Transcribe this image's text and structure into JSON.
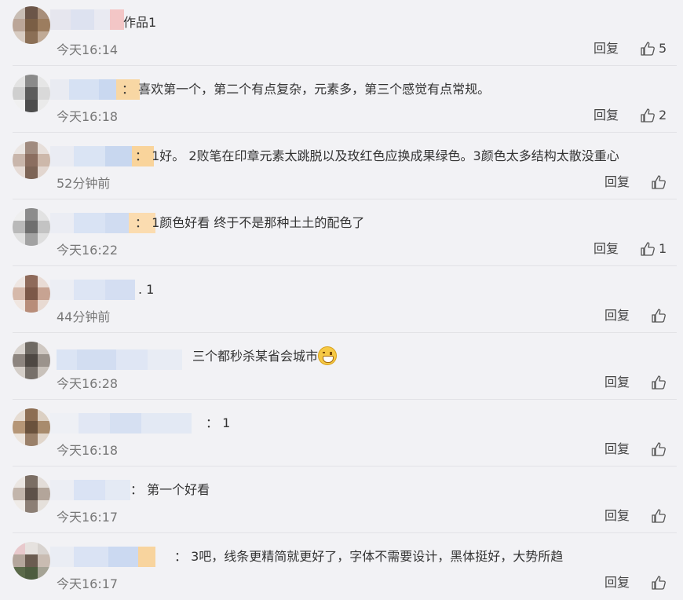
{
  "reply_label": "回复",
  "comments": [
    {
      "text": "作品1",
      "time": "今天16:14",
      "likes": "5"
    },
    {
      "text": "：  喜欢第一个，第二个有点复杂，元素多，第三个感觉有点常规。",
      "time": "今天16:18",
      "likes": "2"
    },
    {
      "text": "：  1好。 2败笔在印章元素太跳脱以及玫红色应换成果绿色。3颜色太多结构太散没重心",
      "time": "52分钟前",
      "likes": ""
    },
    {
      "text": "：  1颜色好看 终于不是那种土土的配色了",
      "time": "今天16:22",
      "likes": "1"
    },
    {
      "text": ".   1",
      "time": "44分钟前",
      "likes": ""
    },
    {
      "text": "三个都秒杀某省会城市",
      "time": "今天16:28",
      "likes": ""
    },
    {
      "text": "：  1",
      "time": "今天16:18",
      "likes": ""
    },
    {
      "text": "：  第一个好看",
      "time": "今天16:17",
      "likes": ""
    },
    {
      "text": "：  3吧，线条更精简就更好了，字体不需要设计，黑体挺好，大势所趋",
      "time": "今天16:17",
      "likes": ""
    }
  ],
  "colors": {
    "background": "#f2f2f5",
    "divider": "#e2e2e6",
    "time": "#777777"
  }
}
